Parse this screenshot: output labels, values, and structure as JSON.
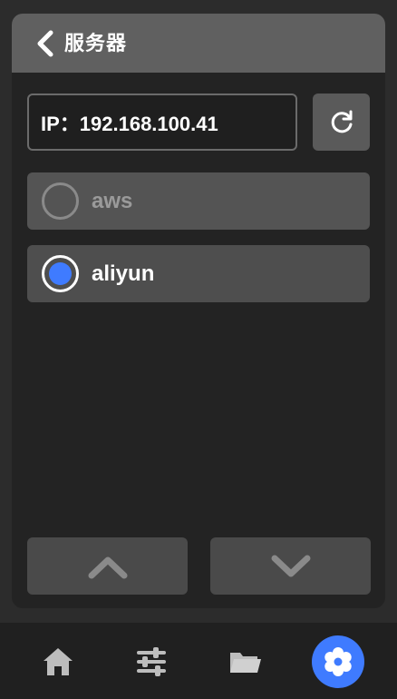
{
  "header": {
    "title": "服务器",
    "back_icon": "chevron-left-icon"
  },
  "ip": {
    "text": "IP：192.168.100.41",
    "refresh_icon": "refresh-icon"
  },
  "servers": [
    {
      "label": "aws",
      "selected": false,
      "enabled": false
    },
    {
      "label": "aliyun",
      "selected": true,
      "enabled": true
    }
  ],
  "pager": {
    "up_icon": "chevron-up-icon",
    "down_icon": "chevron-down-icon"
  },
  "tabs": [
    {
      "icon": "home-icon",
      "active": false
    },
    {
      "icon": "sliders-icon",
      "active": false
    },
    {
      "icon": "folder-icon",
      "active": false
    },
    {
      "icon": "gear-icon",
      "active": true
    }
  ],
  "colors": {
    "accent": "#3f7bff",
    "background": "#2c2c2c",
    "panel": "#232323",
    "header": "#606060"
  }
}
